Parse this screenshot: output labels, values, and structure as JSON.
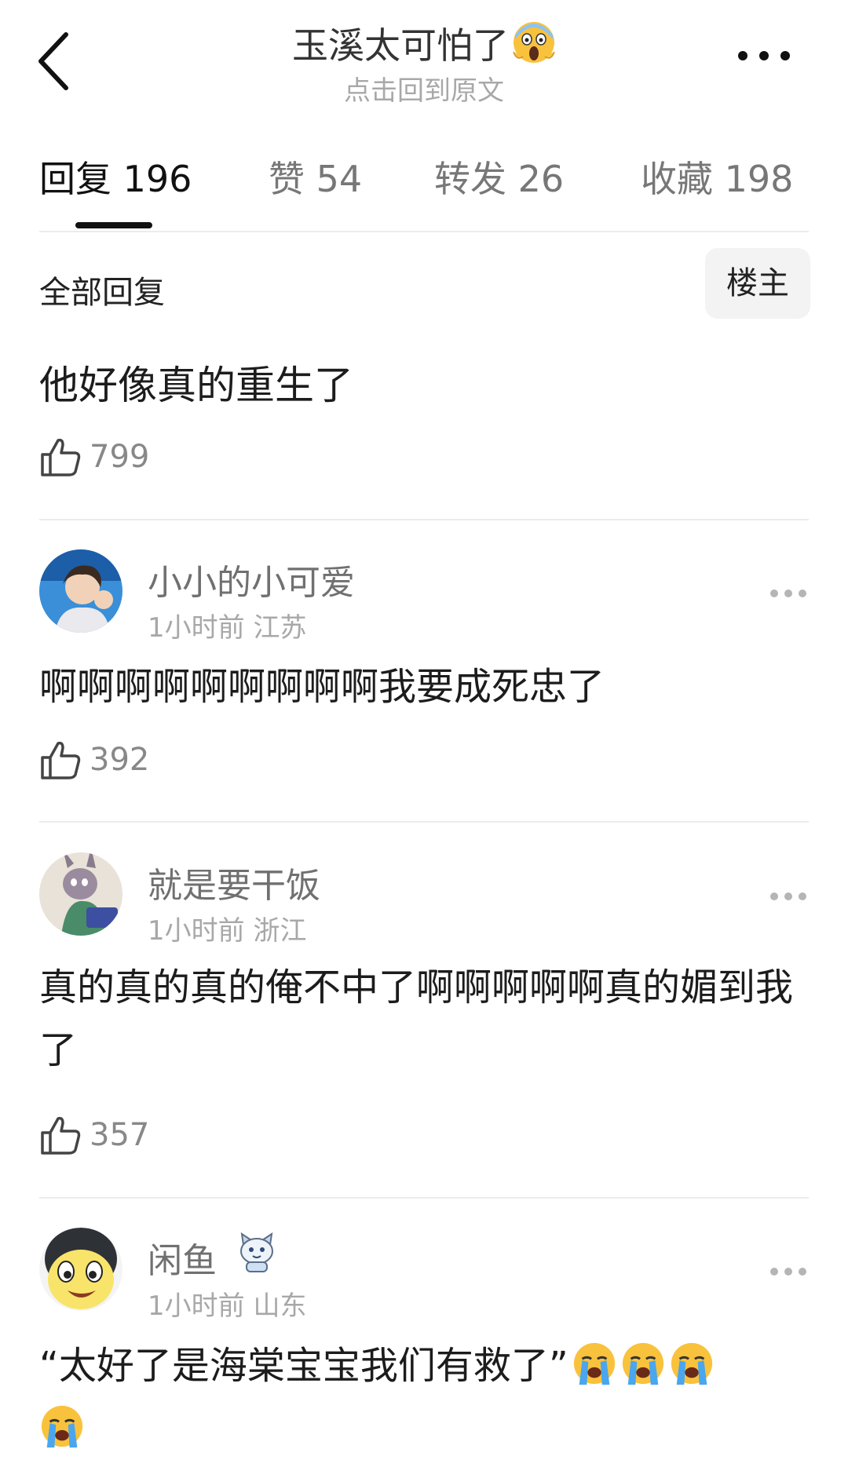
{
  "header": {
    "title": "玉溪太可怕了",
    "subtitle": "点击回到原文"
  },
  "tabs": [
    {
      "label": "回复 196"
    },
    {
      "label": "赞 54"
    },
    {
      "label": "转发 26"
    },
    {
      "label": "收藏 198"
    }
  ],
  "filter": {
    "all_replies": "全部回复",
    "op_only": "楼主"
  },
  "main_post": {
    "text": "他好像真的重生了",
    "likes": "799"
  },
  "comments": [
    {
      "username": "小小的小可爱",
      "meta": "1小时前 江苏",
      "text": "啊啊啊啊啊啊啊啊啊我要成死忠了",
      "likes": "392"
    },
    {
      "username": "就是要干饭",
      "meta": "1小时前 浙江",
      "text": "真的真的真的俺不中了啊啊啊啊啊真的媚到我了",
      "likes": "357"
    },
    {
      "username": "闲鱼",
      "meta": "1小时前 山东",
      "text": "“太好了是海棠宝宝我们有救了”",
      "emoji": "crying-emoji ×4"
    }
  ],
  "colors": {
    "text_primary": "#1a1a1a",
    "text_secondary": "#a8a8a8",
    "divider": "#ececec"
  }
}
